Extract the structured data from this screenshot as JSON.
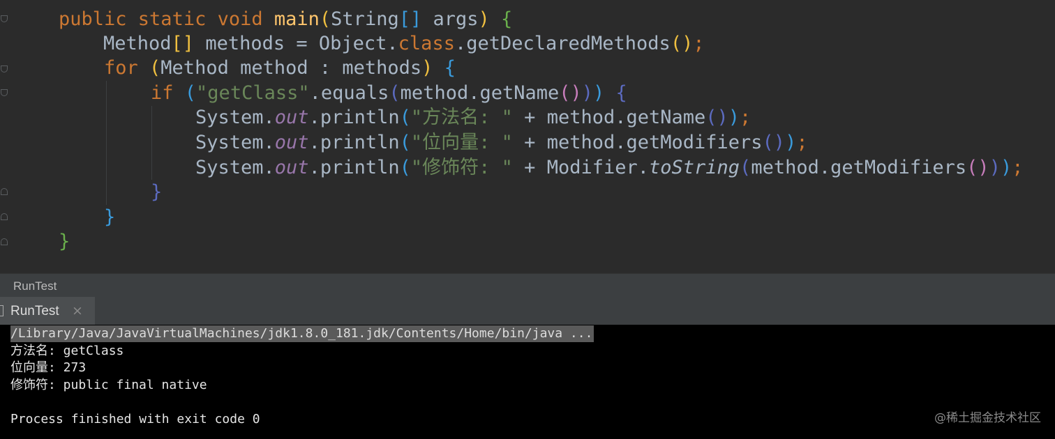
{
  "editor": {
    "lines": [
      {
        "tokens": [
          {
            "t": "public ",
            "c": "kw"
          },
          {
            "t": "static ",
            "c": "kw"
          },
          {
            "t": "void ",
            "c": "kw"
          },
          {
            "t": "main",
            "c": "fn"
          },
          {
            "t": "(",
            "c": "b2"
          },
          {
            "t": "String",
            "c": ""
          },
          {
            "t": "[] ",
            "c": "b3"
          },
          {
            "t": "args",
            "c": ""
          },
          {
            "t": ") ",
            "c": "b2"
          },
          {
            "t": "{",
            "c": "b1"
          }
        ]
      },
      {
        "tokens": [
          {
            "t": "Method",
            "c": ""
          },
          {
            "t": "[] ",
            "c": "b2"
          },
          {
            "t": "methods = Object.",
            "c": ""
          },
          {
            "t": "class",
            "c": "kw"
          },
          {
            "t": ".getDeclaredMethods",
            "c": ""
          },
          {
            "t": "()",
            "c": "b2"
          },
          {
            "t": ";",
            "c": "kw"
          }
        ]
      },
      {
        "tokens": [
          {
            "t": "for ",
            "c": "kw"
          },
          {
            "t": "(",
            "c": "b2"
          },
          {
            "t": "Method method : methods",
            "c": ""
          },
          {
            "t": ") ",
            "c": "b2"
          },
          {
            "t": "{",
            "c": "b3"
          }
        ]
      },
      {
        "tokens": [
          {
            "t": "if ",
            "c": "kw"
          },
          {
            "t": "(",
            "c": "b3"
          },
          {
            "t": "\"getClass\"",
            "c": "str"
          },
          {
            "t": ".equals",
            "c": ""
          },
          {
            "t": "(",
            "c": "b4"
          },
          {
            "t": "method.getName",
            "c": ""
          },
          {
            "t": "()",
            "c": "b5"
          },
          {
            "t": ")",
            "c": "b4"
          },
          {
            "t": ") ",
            "c": "b3"
          },
          {
            "t": "{",
            "c": "b4"
          }
        ]
      },
      {
        "tokens": [
          {
            "t": "System.",
            "c": ""
          },
          {
            "t": "out",
            "c": "field"
          },
          {
            "t": ".println",
            "c": ""
          },
          {
            "t": "(",
            "c": "b3"
          },
          {
            "t": "\"方法名: \"",
            "c": "str"
          },
          {
            "t": " + method.getName",
            "c": ""
          },
          {
            "t": "()",
            "c": "b4"
          },
          {
            "t": ")",
            "c": "b3"
          },
          {
            "t": ";",
            "c": "kw"
          }
        ]
      },
      {
        "tokens": [
          {
            "t": "System.",
            "c": ""
          },
          {
            "t": "out",
            "c": "field"
          },
          {
            "t": ".println",
            "c": ""
          },
          {
            "t": "(",
            "c": "b3"
          },
          {
            "t": "\"位向量: \"",
            "c": "str"
          },
          {
            "t": " + method.getModifiers",
            "c": ""
          },
          {
            "t": "()",
            "c": "b4"
          },
          {
            "t": ")",
            "c": "b3"
          },
          {
            "t": ";",
            "c": "kw"
          }
        ]
      },
      {
        "tokens": [
          {
            "t": "System.",
            "c": ""
          },
          {
            "t": "out",
            "c": "field"
          },
          {
            "t": ".println",
            "c": ""
          },
          {
            "t": "(",
            "c": "b3"
          },
          {
            "t": "\"修饰符: \"",
            "c": "str"
          },
          {
            "t": " + Modifier.",
            "c": ""
          },
          {
            "t": "toString",
            "c": "ital"
          },
          {
            "t": "(",
            "c": "b4"
          },
          {
            "t": "method.getModifiers",
            "c": ""
          },
          {
            "t": "()",
            "c": "b5"
          },
          {
            "t": ")",
            "c": "b4"
          },
          {
            "t": ")",
            "c": "b3"
          },
          {
            "t": ";",
            "c": "kw"
          }
        ]
      },
      {
        "tokens": [
          {
            "t": "}",
            "c": "b4"
          }
        ]
      },
      {
        "tokens": [
          {
            "t": "}",
            "c": "b3"
          }
        ]
      },
      {
        "tokens": [
          {
            "t": "}",
            "c": "b1"
          }
        ]
      }
    ]
  },
  "run_panel": {
    "title": "RunTest",
    "tab_label": "RunTest",
    "tab_close": "×"
  },
  "console": {
    "lines": [
      {
        "text": "/Library/Java/JavaVirtualMachines/jdk1.8.0_181.jdk/Contents/Home/bin/java ...",
        "kind": "cmd"
      },
      {
        "text": "方法名: getClass",
        "kind": "out"
      },
      {
        "text": "位向量: 273",
        "kind": "out"
      },
      {
        "text": "修饰符: public final native",
        "kind": "out"
      },
      {
        "text": "",
        "kind": "out"
      },
      {
        "text": "Process finished with exit code 0",
        "kind": "out"
      }
    ]
  },
  "watermark": "@稀土掘金技术社区",
  "colors": {
    "editor_bg": "#2b2b2b",
    "keyword": "#cc7832",
    "method_decl": "#ffc66d",
    "string": "#6a8759",
    "field": "#9876aa",
    "plain": "#a9b7c6",
    "console_bg": "#000000"
  }
}
